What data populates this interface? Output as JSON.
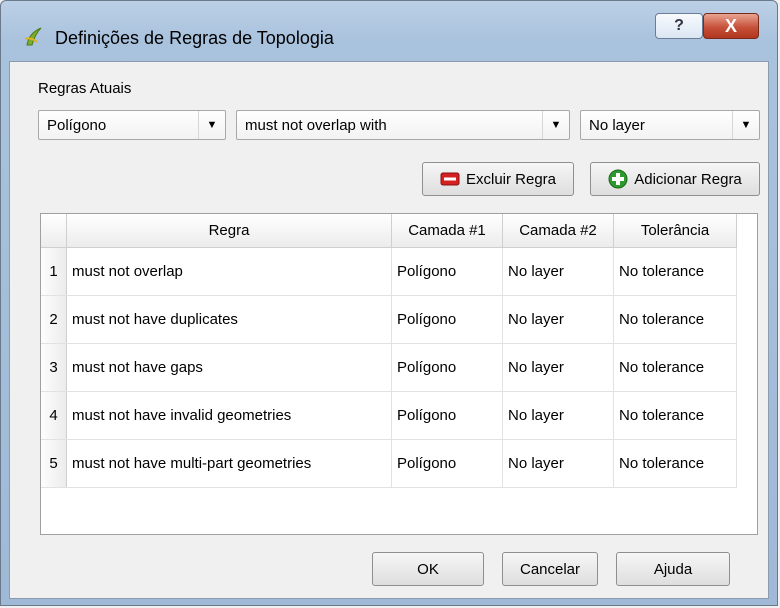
{
  "window": {
    "title": "Definições de Regras de Topologia",
    "help_glyph": "?",
    "close_glyph": "X"
  },
  "form": {
    "section_label": "Regras Atuais",
    "layer_combo": "Polígono",
    "rule_combo": "must not overlap with",
    "target_combo": "No layer",
    "delete_button": "Excluir Regra",
    "add_button": "Adicionar Regra"
  },
  "table": {
    "headers": [
      "Regra",
      "Camada #1",
      "Camada #2",
      "Tolerância"
    ],
    "rows": [
      {
        "num": "1",
        "rule": "must not overlap",
        "layer1": "Polígono",
        "layer2": "No layer",
        "tolerance": "No tolerance"
      },
      {
        "num": "2",
        "rule": "must not have duplicates",
        "layer1": "Polígono",
        "layer2": "No layer",
        "tolerance": "No tolerance"
      },
      {
        "num": "3",
        "rule": "must not have gaps",
        "layer1": "Polígono",
        "layer2": "No layer",
        "tolerance": "No tolerance"
      },
      {
        "num": "4",
        "rule": "must not have invalid geometries",
        "layer1": "Polígono",
        "layer2": "No layer",
        "tolerance": "No tolerance"
      },
      {
        "num": "5",
        "rule": "must not have multi-part geometries",
        "layer1": "Polígono",
        "layer2": "No layer",
        "tolerance": "No tolerance"
      }
    ]
  },
  "footer": {
    "ok": "OK",
    "cancel": "Cancelar",
    "help": "Ajuda"
  },
  "icons": {
    "app": "qgis-icon",
    "delete": "minus-icon",
    "add": "plus-icon"
  },
  "colors": {
    "delete_icon": "#d42020",
    "add_icon": "#2e9a2e"
  }
}
